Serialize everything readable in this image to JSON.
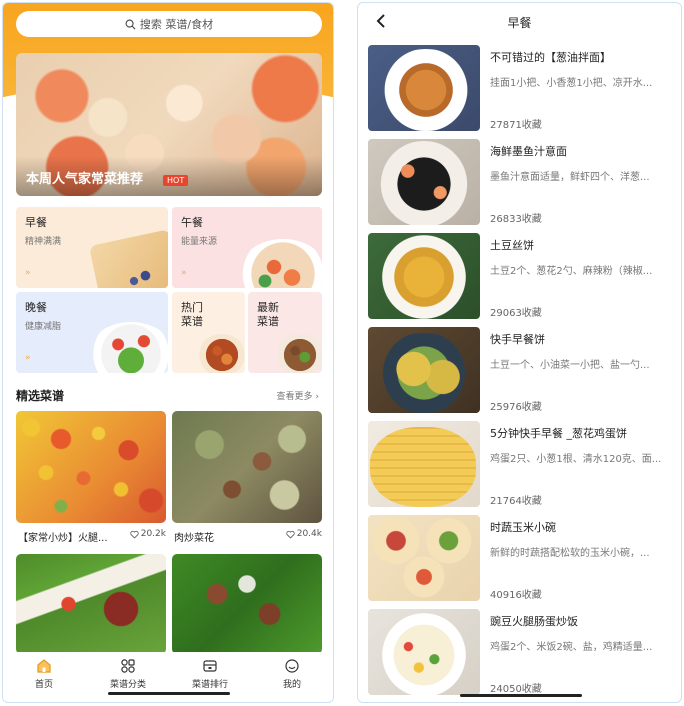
{
  "home": {
    "search": {
      "placeholder": "搜索 菜谱/食材"
    },
    "banner": {
      "title": "本周人气家常菜推荐",
      "badge": "HOT"
    },
    "categories": [
      {
        "title": "早餐",
        "subtitle": "精神满满"
      },
      {
        "title": "午餐",
        "subtitle": "能量来源"
      },
      {
        "title": "晚餐",
        "subtitle": "健康减脂"
      },
      {
        "title": "热门\n菜谱",
        "subtitle": ""
      },
      {
        "title": "最新\n菜谱",
        "subtitle": ""
      }
    ],
    "category_arrow": "»",
    "section": {
      "title": "精选菜谱",
      "more": "查看更多 ›"
    },
    "recipes": [
      {
        "name": "【家常小炒】火腿...",
        "likes": "20.2k"
      },
      {
        "name": "肉炒菜花",
        "likes": "20.4k"
      },
      {
        "name": "",
        "likes": ""
      },
      {
        "name": "",
        "likes": ""
      }
    ],
    "tabs": [
      {
        "label": "首页",
        "icon": "home-icon",
        "active": true
      },
      {
        "label": "菜谱分类",
        "icon": "grid-icon",
        "active": false
      },
      {
        "label": "菜谱排行",
        "icon": "ranking-icon",
        "active": false
      },
      {
        "label": "我的",
        "icon": "profile-icon",
        "active": false
      }
    ]
  },
  "list": {
    "title": "早餐",
    "items": [
      {
        "name": "不可错过的【葱油拌面】",
        "desc": "挂面1小把、小香葱1小把、凉开水...",
        "favorites": "27871收藏"
      },
      {
        "name": "海鲜墨鱼汁意面",
        "desc": "墨鱼汁意面适量，鲜虾四个、洋葱...",
        "favorites": "26833收藏"
      },
      {
        "name": "土豆丝饼",
        "desc": "土豆2个、葱花2勺、麻辣粉（辣椒...",
        "favorites": "29063收藏"
      },
      {
        "name": "快手早餐饼",
        "desc": "土豆一个、小油菜一小把、盐一勺...",
        "favorites": "25976收藏"
      },
      {
        "name": "5分钟快手早餐 _葱花鸡蛋饼",
        "desc": "鸡蛋2只、小葱1根、清水120克、面...",
        "favorites": "21764收藏"
      },
      {
        "name": "时蔬玉米小碗",
        "desc": "新鲜的时蔬搭配松软的玉米小碗，...",
        "favorites": "40916收藏"
      },
      {
        "name": "豌豆火腿肠蛋炒饭",
        "desc": "鸡蛋2个、米饭2碗、盐，鸡精适量...",
        "favorites": "24050收藏"
      }
    ]
  },
  "colors": {
    "accent": "#f8a51e",
    "hot_badge": "#e8452e"
  }
}
